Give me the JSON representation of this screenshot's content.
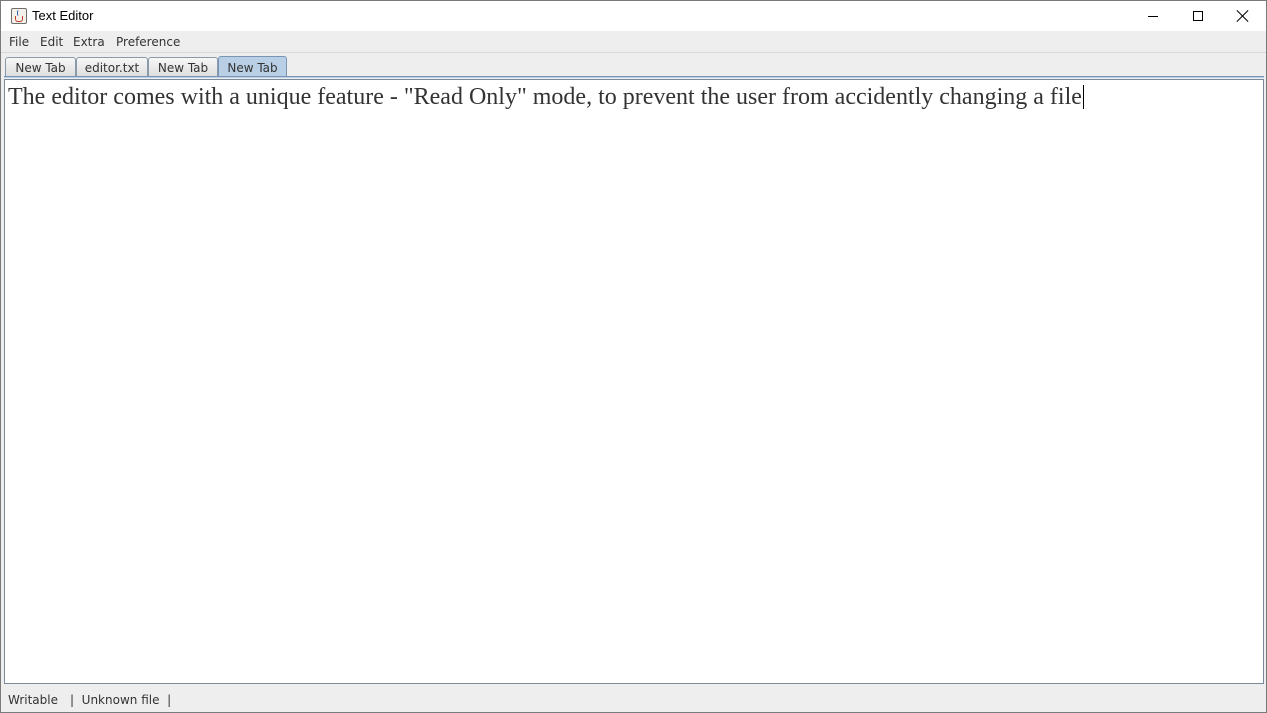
{
  "window": {
    "title": "Text Editor",
    "app_icon": "java-cup-icon",
    "controls": [
      "minimize-icon",
      "maximize-icon",
      "close-icon"
    ]
  },
  "menu": {
    "items": [
      {
        "label": "File"
      },
      {
        "label": "Edit"
      },
      {
        "label": "Extra"
      },
      {
        "label": "Preference"
      }
    ]
  },
  "tabs": [
    {
      "label": "New Tab",
      "selected": false
    },
    {
      "label": "editor.txt",
      "selected": false
    },
    {
      "label": "New Tab",
      "selected": false
    },
    {
      "label": "New Tab",
      "selected": true
    }
  ],
  "editor": {
    "content": "The editor comes with a unique feature - \"Read Only\" mode, to prevent the user from accidently changing a file"
  },
  "status": {
    "mode": "Writable",
    "file": "|  Unknown file  |"
  },
  "colors": {
    "selected_tab": "#b8cfe5",
    "chrome": "#eeeeee"
  }
}
